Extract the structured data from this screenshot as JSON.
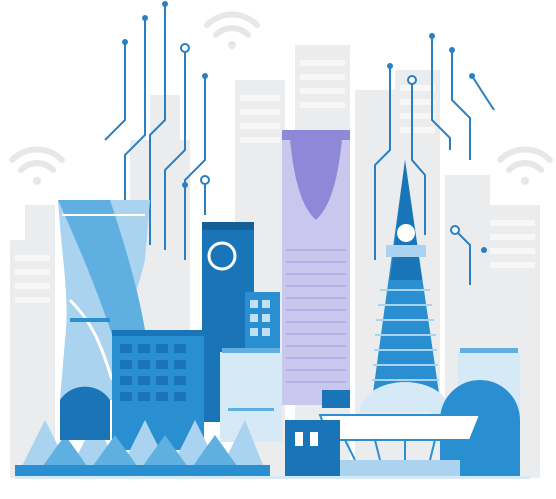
{
  "illustration": {
    "subject": "smart-city-riyadh-skyline",
    "icons": [
      "wifi-icon",
      "circuit-line-icon"
    ],
    "colors": {
      "background": "#ffffff",
      "ghost_buildings": "#ebecee",
      "dark_blue": "#1a74b8",
      "mid_blue": "#2a8fd0",
      "light_blue": "#a9d3ee",
      "pale_blue": "#d6e9f6",
      "lavender": "#c9c7ee",
      "purple": "#8e88d8",
      "circuit": "#2a7fc2",
      "wifi": "#e6e7e9"
    }
  }
}
